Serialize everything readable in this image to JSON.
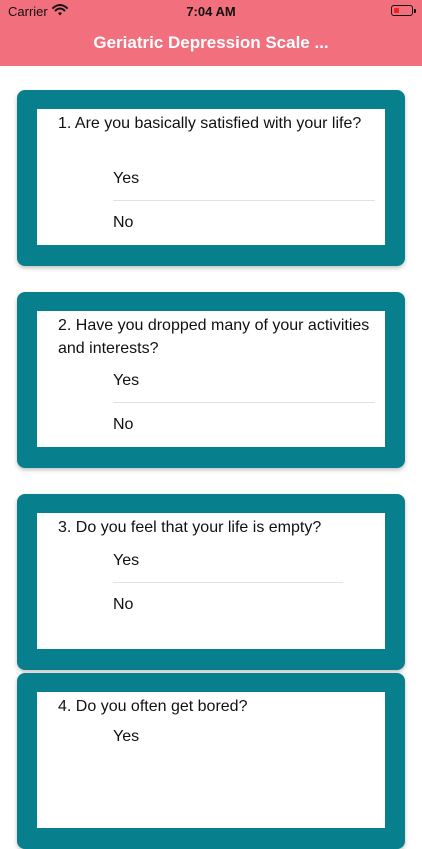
{
  "status_bar": {
    "carrier": "Carrier",
    "time": "7:04 AM",
    "battery_color": "#ee2222"
  },
  "header": {
    "title": "Geriatric Depression Scale ...",
    "background": "#f26f7e"
  },
  "theme": {
    "card_color": "#087f8c"
  },
  "questions": [
    {
      "text": "1. Are you basically satisfied with your life?",
      "options": [
        "Yes",
        "No"
      ]
    },
    {
      "text": "2. Have you dropped many of your activities and interests?",
      "options": [
        "Yes",
        "No"
      ]
    },
    {
      "text": "3. Do you feel that your life is empty?",
      "options": [
        "Yes",
        "No"
      ]
    },
    {
      "text": "4. Do you often get bored?",
      "options": [
        "Yes"
      ]
    }
  ]
}
